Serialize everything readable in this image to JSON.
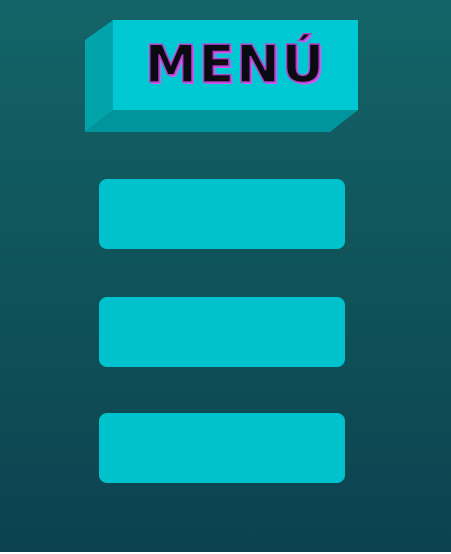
{
  "title": {
    "text": "MENÚ"
  },
  "menu": {
    "buttons": [
      {
        "label": ""
      },
      {
        "label": ""
      },
      {
        "label": ""
      }
    ]
  },
  "colors": {
    "background_top": "#136468",
    "background_bottom": "#0c4250",
    "block_face": "#00c8d2",
    "block_side": "#009aa0",
    "button_fill": "#00c2cc",
    "title_outline": "#b03ec7"
  }
}
